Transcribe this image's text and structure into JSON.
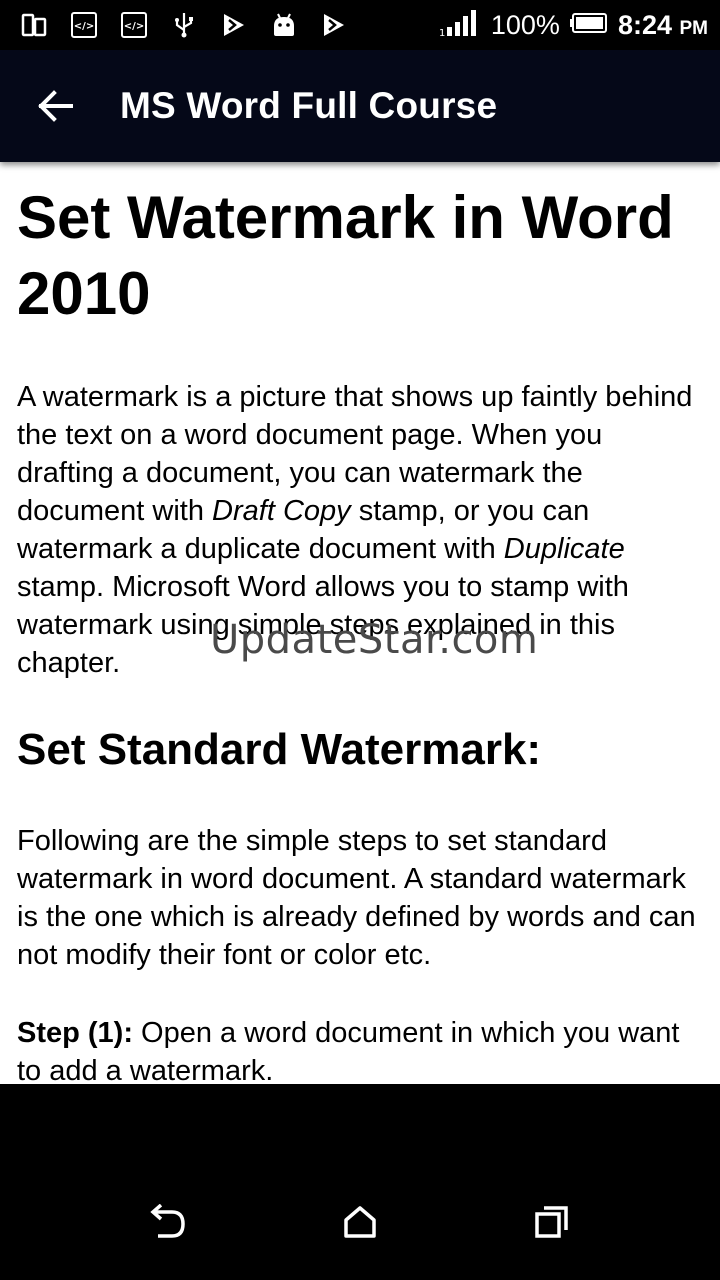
{
  "status_bar": {
    "signal_icon": "signal-bars-icon",
    "battery_percent": "100%",
    "time": "8:24",
    "ampm": "PM"
  },
  "app_bar": {
    "title": "MS Word Full Course",
    "back_icon": "arrow-left-icon"
  },
  "article": {
    "title": "Set Watermark in Word 2010",
    "intro": {
      "p1": "A watermark is a picture that shows up faintly behind the text on a word document page. When you drafting a document, you can watermark the document with ",
      "em1": "Draft Copy",
      "p2": " stamp, or you can watermark a duplicate document with ",
      "em2": "Duplicate",
      "p3": " stamp. Microsoft Word allows you to stamp with watermark using simple steps explained in this chapter."
    },
    "section_heading": "Set Standard Watermark:",
    "section_para": "Following are the simple steps to set standard watermark in word document. A standard watermark is the one which is already defined by words and can not modify their font or color etc.",
    "step1_label": "Step (1):",
    "step1_text": " Open a word document in which you want to add a watermark."
  },
  "overlay_watermark": "UpdateStar.com",
  "nav": {
    "back_icon": "nav-back-icon",
    "home_icon": "nav-home-icon",
    "recents_icon": "nav-recents-icon"
  }
}
